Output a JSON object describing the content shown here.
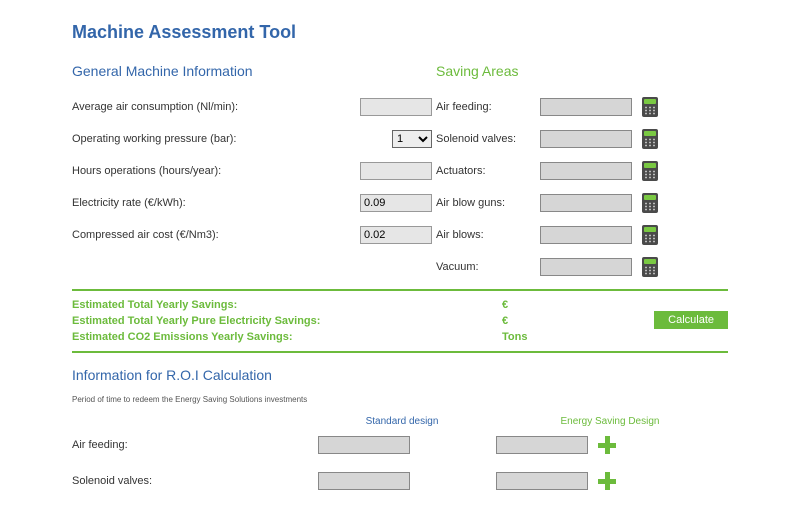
{
  "title": "Machine Assessment Tool",
  "general": {
    "heading": "General Machine Information",
    "fields": {
      "air_consumption": {
        "label": "Average air consumption (Nl/min):",
        "value": ""
      },
      "pressure": {
        "label": "Operating working pressure (bar):",
        "value": "1"
      },
      "hours": {
        "label": "Hours operations (hours/year):",
        "value": ""
      },
      "elec_rate": {
        "label": "Electricity rate (€/kWh):",
        "value": "0.09"
      },
      "air_cost": {
        "label": "Compressed air cost (€/Nm3):",
        "value": "0.02"
      }
    }
  },
  "saving": {
    "heading": "Saving Areas",
    "items": [
      {
        "label": "Air feeding:",
        "value": ""
      },
      {
        "label": "Solenoid valves:",
        "value": ""
      },
      {
        "label": "Actuators:",
        "value": ""
      },
      {
        "label": "Air blow guns:",
        "value": ""
      },
      {
        "label": "Air blows:",
        "value": ""
      },
      {
        "label": "Vacuum:",
        "value": ""
      }
    ]
  },
  "summary": {
    "line1_label": "Estimated Total Yearly Savings:",
    "line1_value": "€",
    "line2_label": "Estimated Total Yearly Pure Electricity Savings:",
    "line2_value": "€",
    "line3_label": "Estimated CO2 Emissions Yearly Savings:",
    "line3_value": "Tons",
    "calculate_label": "Calculate"
  },
  "roi": {
    "heading": "Information for R.O.I Calculation",
    "note": "Period of time to redeem the Energy Saving Solutions investments",
    "col_std": "Standard design",
    "col_esd": "Energy Saving Design",
    "rows": [
      {
        "label": "Air feeding:",
        "std": "",
        "esd": ""
      },
      {
        "label": "Solenoid valves:",
        "std": "",
        "esd": ""
      }
    ]
  }
}
